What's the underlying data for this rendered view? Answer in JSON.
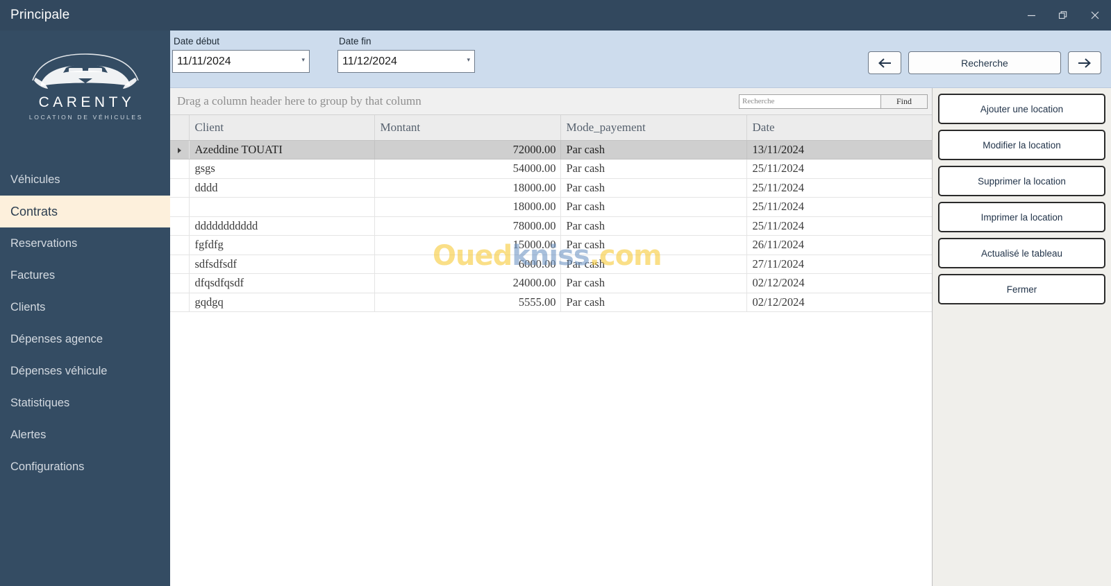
{
  "window": {
    "title": "Principale",
    "controls": [
      {
        "name": "minimize",
        "glyph": "minimize-icon"
      },
      {
        "name": "restore",
        "glyph": "restore-icon"
      },
      {
        "name": "close",
        "glyph": "close-icon"
      }
    ]
  },
  "sidebar": {
    "logo": {
      "name": "CARENTY",
      "tagline": "LOCATION DE VÉHICULES",
      "icon": "car-logo-icon"
    },
    "items": [
      {
        "label": "Véhicules",
        "active": false
      },
      {
        "label": "Contrats",
        "active": true
      },
      {
        "label": "Reservations",
        "active": false
      },
      {
        "label": "Factures",
        "active": false
      },
      {
        "label": "Clients",
        "active": false
      },
      {
        "label": "Dépenses agence",
        "active": false
      },
      {
        "label": "Dépenses véhicule",
        "active": false
      },
      {
        "label": "Statistiques",
        "active": false
      },
      {
        "label": "Alertes",
        "active": false
      },
      {
        "label": "Configurations",
        "active": false
      }
    ]
  },
  "filterbar": {
    "date_debut": {
      "label": "Date début",
      "value": "11/11/2024"
    },
    "date_fin": {
      "label": "Date fin",
      "value": "11/12/2024"
    },
    "prev_label": "←",
    "next_label": "→",
    "search_label": "Recherche"
  },
  "grid": {
    "group_panel_text": "Drag a column header here to group by that column",
    "search_placeholder": "Recherche",
    "search_value": "",
    "find_label": "Find",
    "columns": [
      "Client",
      "Montant",
      "Mode_payement",
      "Date"
    ],
    "rows": [
      {
        "client": "Azeddine TOUATI",
        "montant": "72000.00",
        "mode": "Par cash",
        "date": "13/11/2024",
        "selected": true
      },
      {
        "client": "gsgs",
        "montant": "54000.00",
        "mode": "Par cash",
        "date": "25/11/2024",
        "selected": false
      },
      {
        "client": "dddd",
        "montant": "18000.00",
        "mode": "Par cash",
        "date": "25/11/2024",
        "selected": false
      },
      {
        "client": "",
        "montant": "18000.00",
        "mode": "Par cash",
        "date": "25/11/2024",
        "selected": false
      },
      {
        "client": "ddddddddddd",
        "montant": "78000.00",
        "mode": "Par cash",
        "date": "25/11/2024",
        "selected": false
      },
      {
        "client": "fgfdfg",
        "montant": "15000.00",
        "mode": "Par cash",
        "date": "26/11/2024",
        "selected": false
      },
      {
        "client": "sdfsdfsdf",
        "montant": "6000.00",
        "mode": "Par cash",
        "date": "27/11/2024",
        "selected": false
      },
      {
        "client": "dfqsdfqsdf",
        "montant": "24000.00",
        "mode": "Par cash",
        "date": "02/12/2024",
        "selected": false
      },
      {
        "client": "gqdgq",
        "montant": "5555.00",
        "mode": "Par cash",
        "date": "02/12/2024",
        "selected": false
      }
    ]
  },
  "watermark": {
    "part1": "Oued",
    "part2": "kniss",
    "part3": ".com"
  },
  "actions": [
    {
      "label": "Ajouter une location"
    },
    {
      "label": "Modifier la location"
    },
    {
      "label": "Supprimer la location"
    },
    {
      "label": "Imprimer la location"
    },
    {
      "label": "Actualisé le tableau"
    },
    {
      "label": "Fermer"
    }
  ],
  "colors": {
    "titlebar": "#32485e",
    "sidebar": "#344c63",
    "active_nav": "#fdf0dc",
    "filterbar": "#cddced",
    "right_panel": "#f0efeb",
    "row_selected": "#cfcfcf"
  }
}
